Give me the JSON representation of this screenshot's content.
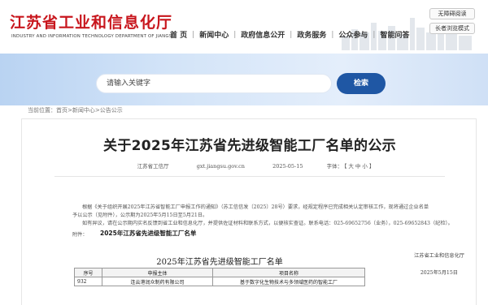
{
  "header": {
    "site_title": "江苏省工业和信息化厅",
    "site_subtitle": "INDUSTRY AND INFORMATION TECHNOLOGY DEPARTMENT OF JIANGSU",
    "nav": [
      "首 页",
      "新闻中心",
      "政府信息公开",
      "政务服务",
      "公众参与",
      "智能问答"
    ],
    "tools": [
      "无障碍阅读",
      "长者浏览模式"
    ]
  },
  "search": {
    "placeholder": "请输入关键字",
    "button_label": "检索"
  },
  "breadcrumb": {
    "prefix": "当前位置：",
    "items": [
      "首页",
      "新闻中心",
      "公告公示"
    ],
    "separator": ">"
  },
  "article": {
    "title": "关于2025年江苏省先进级智能工厂名单的公示",
    "source": "江苏省工信厅",
    "website": "gxt.jiangsu.gov.cn",
    "date": "2025-05-15",
    "font_size_label": "字体：",
    "font_sizes": [
      "【",
      "大",
      "中",
      "小",
      "】"
    ],
    "paragraph_1": "根据《关于组织开展2025年江苏省智能工厂申报工作的通知》（苏工信信发〔2025〕28号）要求，经规定程序已完成相关认定审核工作，现将通过企业名单予以公示（见附件），公示期为2025年5月15日至5月21日。",
    "paragraph_2": "如有异议，请在公示期内实名反馈到省工业和信息化厅，并提供佐证材料和联系方式，以便核实查证。联系电话：025-69652756（业务），025-69652843（纪检）。",
    "attachment_label": "附件：",
    "attachment_link": "2025年江苏省先进级智能工厂名单",
    "sign_org": "江苏省工业和信息化厅",
    "sign_date": "2025年5月15日"
  },
  "document": {
    "title": "2025年江苏省先进级智能工厂名单",
    "columns": [
      "序号",
      "申报主体",
      "项目名称"
    ],
    "rows": [
      [
        "932",
        "连云港润众制药有限公司",
        "基于数字化生物技术与多领域医药的智能工厂"
      ]
    ]
  }
}
